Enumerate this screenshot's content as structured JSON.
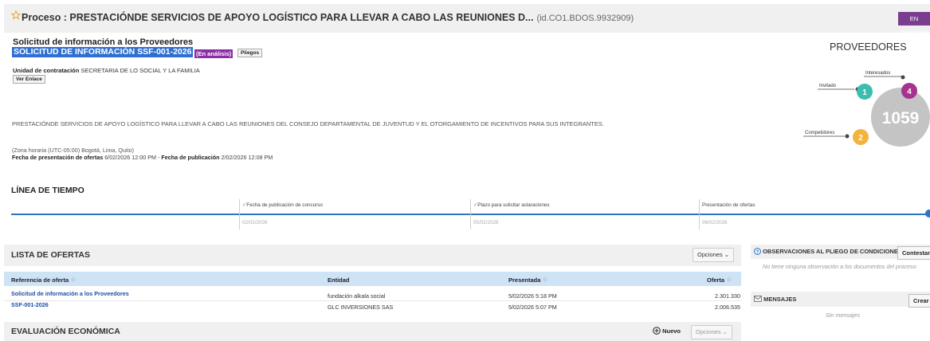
{
  "header": {
    "title": "Proceso : PRESTACIÓNDE SERVICIOS DE APOYO LOGÍSTICO PARA LLEVAR A CABO LAS REUNIONES D...",
    "process_id": "(id.CO1.BDOS.9932909)",
    "status": "EN ANÁLISIS"
  },
  "request": {
    "heading": "Solicitud de información a los Proveedores",
    "code": "SOLICITUD DE INFORMACIÓN SSF-001-2026",
    "badge": "(En análisis)",
    "pliegos_label": "Pliegos",
    "unit_label": "Unidad de contratación",
    "unit_value": "SECRETARIA DE LO SOCIAL Y LA FAMILIA",
    "link_label": "Ver Enlace",
    "description": "PRESTACIÓNDE SERVICIOS DE APOYO LOGÍSTICO PARA LLEVAR A CABO LAS REUNIONES DEL CONSEJO DEPARTAMENTAL DE JUVENTUD Y EL OTORGAMIENTO DE INCENTIVOS PARA SUS INTEGRANTES.",
    "timezone": "(Zona horaria (UTC-05:00) Bogotá, Lima, Quito)",
    "offers_date_label": "Fecha de presentación de ofertas",
    "offers_date_value": "6/02/2026 12:00 PM",
    "separator": "-",
    "publish_date_label": "Fecha de publicación",
    "publish_date_value": "2/02/2026 12:08 PM"
  },
  "providers": {
    "title": "PROVEEDORES",
    "total": "1059",
    "invitado_label": "Invitado",
    "invitado_count": "1",
    "interesados_label": "Interesados",
    "interesados_count": "4",
    "competidores_label": "Competidores",
    "competidores_count": "2",
    "colors": {
      "invitado": "#3dbdb0",
      "interesados": "#a7328f",
      "competidores": "#f3b33d",
      "total": "#c4c4c4"
    }
  },
  "timeline": {
    "heading": "LÍNEA DE TIEMPO",
    "events": [
      {
        "label": "Fecha de publicación de concurso",
        "date": "02/02/2026",
        "done": true
      },
      {
        "label": "Plazo para solicitar aclaraciones",
        "date": "05/02/2026",
        "done": true
      },
      {
        "label": "Presentación de ofertas",
        "date": "06/02/2026",
        "done": false
      }
    ]
  },
  "offers": {
    "title": "LISTA DE OFERTAS",
    "options_label": "Opciones",
    "columns": [
      "Referencia de oferta",
      "Entidad",
      "Presentada",
      "Oferta"
    ],
    "rows": [
      {
        "ref": "Solicitud de información a los Proveedores",
        "entity": "fundación alkala social",
        "date": "5/02/2026 5:18 PM",
        "amount": "2.301.330"
      },
      {
        "ref": "SSF-001-2026",
        "entity": "GLC INVERSIONES SAS",
        "date": "5/02/2026 5:07 PM",
        "amount": "2.006.535"
      }
    ]
  },
  "economic": {
    "title": "EVALUACIÓN ECONÓMICA",
    "new_label": "Nuevo",
    "options_label": "Opciones"
  },
  "observations": {
    "title": "OBSERVACIONES AL PLIEGO DE CONDICIONES",
    "button": "Contestar",
    "empty": "No tiene ninguna observación a los documentos del proceso"
  },
  "messages": {
    "title": "MENSAJES",
    "button": "Crear",
    "empty": "Sin mensajes"
  }
}
